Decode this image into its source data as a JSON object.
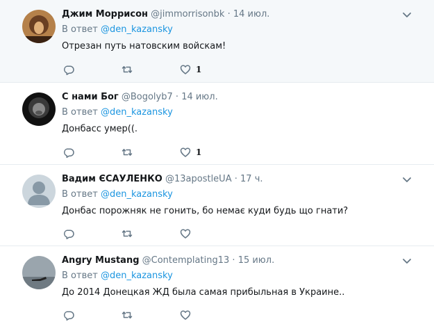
{
  "reply_prefix": "В ответ",
  "colors": {
    "link": "#1b95e0",
    "muted": "#657786",
    "highlight_bg": "#f5f8fa"
  },
  "icons": {
    "reply": "reply-icon",
    "retweet": "retweet-icon",
    "like": "heart-icon",
    "menu": "chevron-down-icon"
  },
  "tweets": [
    {
      "name": "Джим Моррисон",
      "handle": "@jimmorrisonbk",
      "sep": "·",
      "time": "14 июл.",
      "reply_to": "@den_kazansky",
      "text": "Отрезан путь натовским войскам!",
      "likes": "1"
    },
    {
      "name": "С нами Бог",
      "handle": "@Bogolyb7",
      "sep": "·",
      "time": "14 июл.",
      "reply_to": "@den_kazansky",
      "text": "Донбасс умер((.",
      "likes": "1"
    },
    {
      "name": "Вадим ЄСАУЛЕНКО",
      "handle": "@13apostleUA",
      "sep": "·",
      "time": "17 ч.",
      "reply_to": "@den_kazansky",
      "text": "Донбас порожняк не гонить, бо немає куди будь що гнати?",
      "likes": ""
    },
    {
      "name": "Angry Mustang",
      "handle": "@Contemplating13",
      "sep": "·",
      "time": "15 июл.",
      "reply_to": "@den_kazansky",
      "text": "До 2014 Донецкая ЖД была самая прибыльная в Украине..",
      "likes": ""
    }
  ]
}
